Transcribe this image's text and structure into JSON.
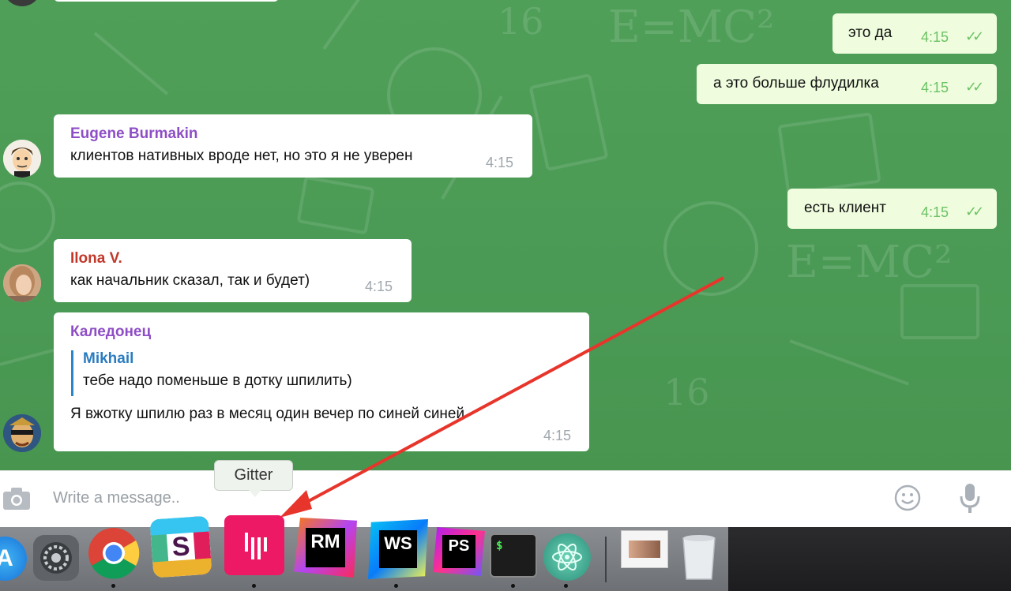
{
  "messages": {
    "out1": {
      "text": "это да",
      "time": "4:15"
    },
    "out2": {
      "text": "а это больше флудилка",
      "time": "4:15"
    },
    "eugene": {
      "sender": "Eugene Burmakin",
      "text": "клиентов нативных вроде нет, но это я не уверен",
      "time": "4:15"
    },
    "out3": {
      "text": "есть клиент",
      "time": "4:15"
    },
    "ilona": {
      "sender": "Ilona V.",
      "text": "как начальник сказал, так и будет)",
      "time": "4:15"
    },
    "kaledonets": {
      "sender": "Каледонец",
      "reply_name": "Mikhail",
      "reply_text": "тебе надо поменьше в дотку шпилить)",
      "text": "Я вжотку шпилю раз в месяц один вечер по синей синей",
      "time": "4:15"
    }
  },
  "composer": {
    "placeholder": "Write a message.."
  },
  "tooltip": {
    "label": "Gitter"
  },
  "dock": {
    "items": [
      "app-store",
      "system-preferences",
      "chrome",
      "slack",
      "gitter",
      "rubymine",
      "webstorm",
      "phpstorm",
      "terminal",
      "atom",
      "preview",
      "trash"
    ],
    "labels": {
      "slack": "S",
      "rubymine": "RM",
      "webstorm": "WS",
      "phpstorm": "PS",
      "terminal": "$"
    }
  },
  "colors": {
    "chat_bg": "#4a9a55",
    "outgoing_bubble": "#effdde",
    "eugene": "#8e4ec6",
    "ilona": "#c0392b",
    "kaledonets": "#8e4ec6",
    "reply": "#2a7cc0",
    "check": "#6cc264",
    "arrow": "#e8352b"
  }
}
